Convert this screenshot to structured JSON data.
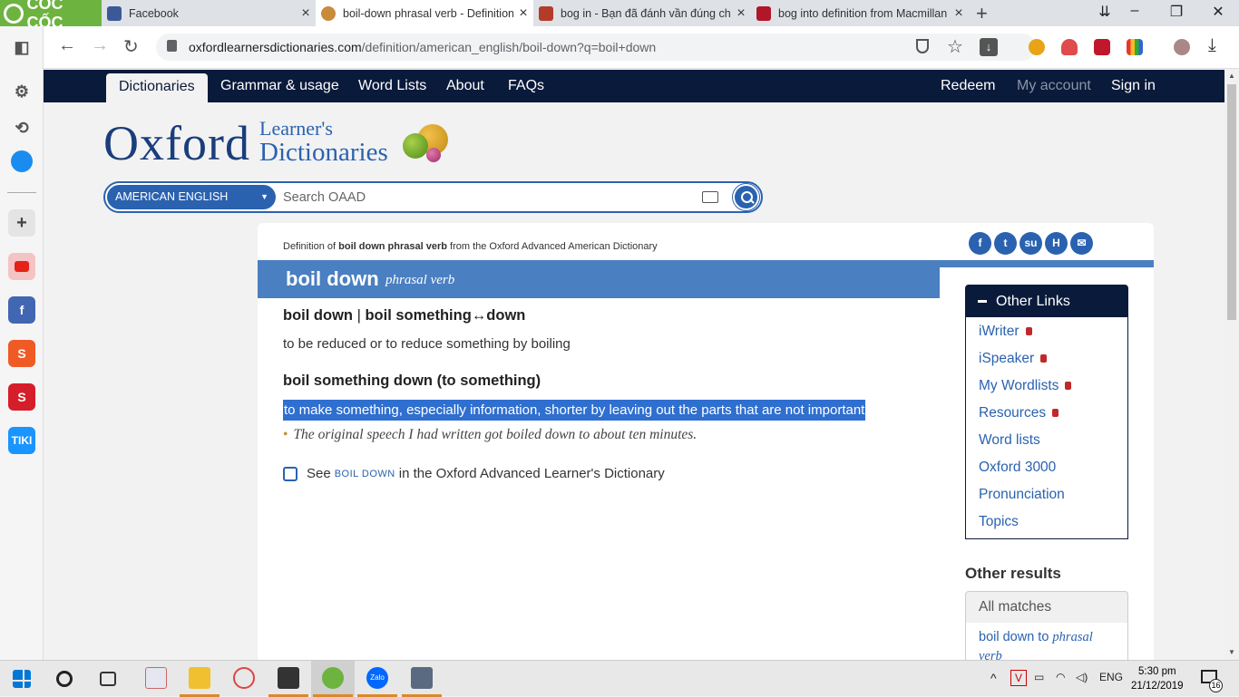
{
  "browser": {
    "brand": "CỐC CỐC",
    "tabs": [
      {
        "title": "Facebook",
        "favicon_color": "#3b5998"
      },
      {
        "title": "boil-down phrasal verb - Definition",
        "favicon_color": "#c98a3a"
      },
      {
        "title": "bog in - Bạn đã đánh vần đúng ch",
        "favicon_color": "#b23b2a"
      },
      {
        "title": "bog into definition from Macmillan",
        "favicon_color": "#b0182a"
      }
    ],
    "url_host": "oxfordlearnersdictionaries.com",
    "url_path": "/definition/american_english/boil-down?q=boil+down"
  },
  "site_nav": {
    "items": [
      "Dictionaries",
      "Grammar & usage",
      "Word Lists",
      "About",
      "FAQs"
    ],
    "right": [
      "Redeem",
      "My account",
      "Sign in"
    ]
  },
  "logo": {
    "oxford": "Oxford",
    "learners": "Learner's",
    "dictionaries": "Dictionaries"
  },
  "search": {
    "dictionary": "AMERICAN ENGLISH",
    "placeholder": "Search OAAD"
  },
  "entry": {
    "crumb_pre": "Definition of ",
    "crumb_bold": "boil down phrasal verb",
    "crumb_post": " from the Oxford Advanced American Dictionary",
    "headword": "boil down",
    "pos": "phrasal verb",
    "sense1_head_a": "boil down",
    "sense1_sep": " | ",
    "sense1_head_b": "boil something↔down",
    "sense1_def": "to be reduced or to reduce something by boiling",
    "sense2_head": "boil something down (to something)",
    "sense2_def": "to make something, especially information, shorter by leaving out the parts that are not important",
    "sense2_example": "The original speech I had written got boiled down to about ten minutes.",
    "see_pre": "See ",
    "see_link": "BOIL DOWN",
    "see_post": " in the Oxford Advanced Learner's Dictionary"
  },
  "share_icons": [
    "facebook-icon",
    "twitter-icon",
    "stumbleupon-icon",
    "hi-icon",
    "email-icon"
  ],
  "other_links": {
    "title": "Other Links",
    "items": [
      {
        "label": "iWriter",
        "locked": true
      },
      {
        "label": "iSpeaker",
        "locked": true
      },
      {
        "label": "My Wordlists",
        "locked": true
      },
      {
        "label": "Resources",
        "locked": true
      },
      {
        "label": "Word lists",
        "locked": false
      },
      {
        "label": "Oxford 3000",
        "locked": false
      },
      {
        "label": "Pronunciation",
        "locked": false
      },
      {
        "label": "Topics",
        "locked": false
      }
    ]
  },
  "other_results": {
    "title": "Other results",
    "all_matches": "All matches",
    "result1_word": "boil down to",
    "result1_pos": "phrasal verb"
  },
  "taskbar": {
    "lang": "ENG",
    "time": "5:30 pm",
    "date": "21/12/2019",
    "notif": "16"
  }
}
